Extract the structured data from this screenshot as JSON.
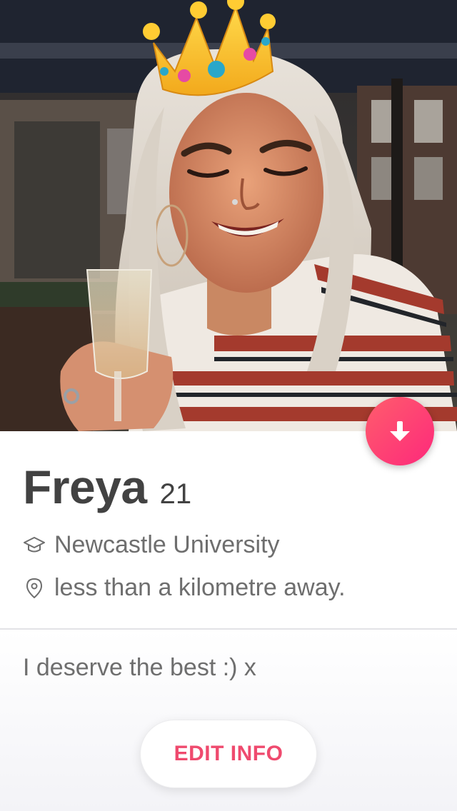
{
  "profile": {
    "name": "Freya",
    "age": "21",
    "school": "Newcastle University",
    "distance": "less than a kilometre away.",
    "bio": "I deserve the best :) x"
  },
  "actions": {
    "edit_info_label": "EDIT INFO"
  },
  "icons": {
    "school": "graduation-cap-icon",
    "distance": "location-pin-icon",
    "collapse": "arrow-down-icon"
  },
  "colors": {
    "accent_gradient_start": "#ff5d6c",
    "accent_gradient_end": "#fd297b",
    "edit_button_text": "#ef4a6e",
    "name_text": "#424242",
    "secondary_text": "#6e6e6e"
  }
}
